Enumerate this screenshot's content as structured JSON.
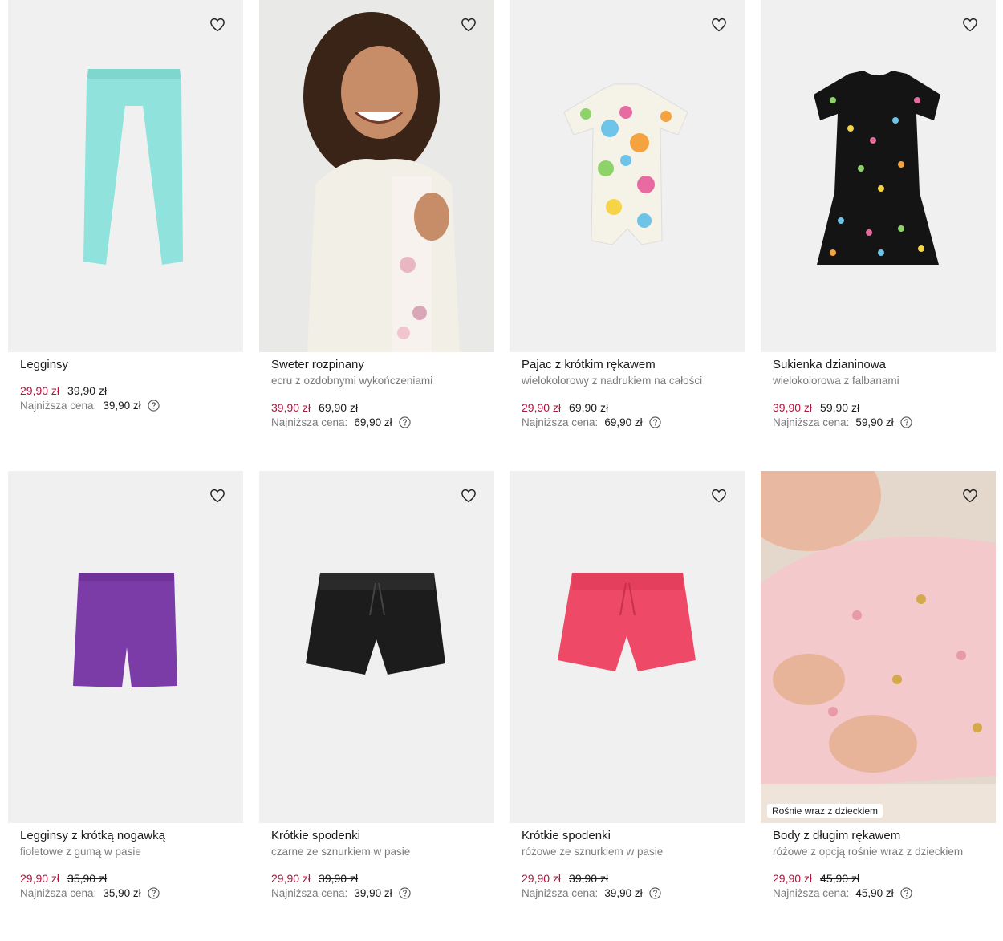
{
  "products": [
    {
      "name": "Legginsy",
      "desc": "",
      "price": "29,90 zł",
      "old_price": "39,90 zł",
      "lowest_label": "Najniższa cena:",
      "lowest_price": "39,90 zł",
      "badge": "",
      "colors": {
        "garment": "#8fe3dc"
      }
    },
    {
      "name": "Sweter rozpinany",
      "desc": "ecru z ozdobnymi wykończeniami",
      "price": "39,90 zł",
      "old_price": "69,90 zł",
      "lowest_label": "Najniższa cena:",
      "lowest_price": "69,90 zł",
      "badge": "",
      "colors": {
        "garment": "#f2efe6"
      }
    },
    {
      "name": "Pajac z krótkim rękawem",
      "desc": "wielokolorowy z nadrukiem na całości",
      "price": "29,90 zł",
      "old_price": "69,90 zł",
      "lowest_label": "Najniższa cena:",
      "lowest_price": "69,90 zł",
      "badge": "",
      "colors": {
        "garment": "#f5f3e8"
      }
    },
    {
      "name": "Sukienka dzianinowa",
      "desc": "wielokolorowa z falbanami",
      "price": "39,90 zł",
      "old_price": "59,90 zł",
      "lowest_label": "Najniższa cena:",
      "lowest_price": "59,90 zł",
      "badge": "",
      "colors": {
        "garment": "#141414"
      }
    },
    {
      "name": "Legginsy z krótką nogawką",
      "desc": "fioletowe z gumą w pasie",
      "price": "29,90 zł",
      "old_price": "35,90 zł",
      "lowest_label": "Najniższa cena:",
      "lowest_price": "35,90 zł",
      "badge": "",
      "colors": {
        "garment": "#7b3ca8"
      }
    },
    {
      "name": "Krótkie spodenki",
      "desc": "czarne ze sznurkiem w pasie",
      "price": "29,90 zł",
      "old_price": "39,90 zł",
      "lowest_label": "Najniższa cena:",
      "lowest_price": "39,90 zł",
      "badge": "",
      "colors": {
        "garment": "#1c1c1c"
      }
    },
    {
      "name": "Krótkie spodenki",
      "desc": "różowe ze sznurkiem w pasie",
      "price": "29,90 zł",
      "old_price": "39,90 zł",
      "lowest_label": "Najniższa cena:",
      "lowest_price": "39,90 zł",
      "badge": "",
      "colors": {
        "garment": "#ee4a67"
      }
    },
    {
      "name": "Body z długim rękawem",
      "desc": "różowe z opcją rośnie wraz z dzieckiem",
      "price": "29,90 zł",
      "old_price": "45,90 zł",
      "lowest_label": "Najniższa cena:",
      "lowest_price": "45,90 zł",
      "badge": "Rośnie wraz z dzieckiem",
      "colors": {
        "garment": "#f3c9cc"
      }
    }
  ],
  "icons": {
    "favorite": "heart-outline-icon",
    "info": "question-circle-icon"
  },
  "theme": {
    "sale_color": "#b0153d",
    "muted_text": "#7a7a7a",
    "image_bg": "#f0f0f0"
  }
}
